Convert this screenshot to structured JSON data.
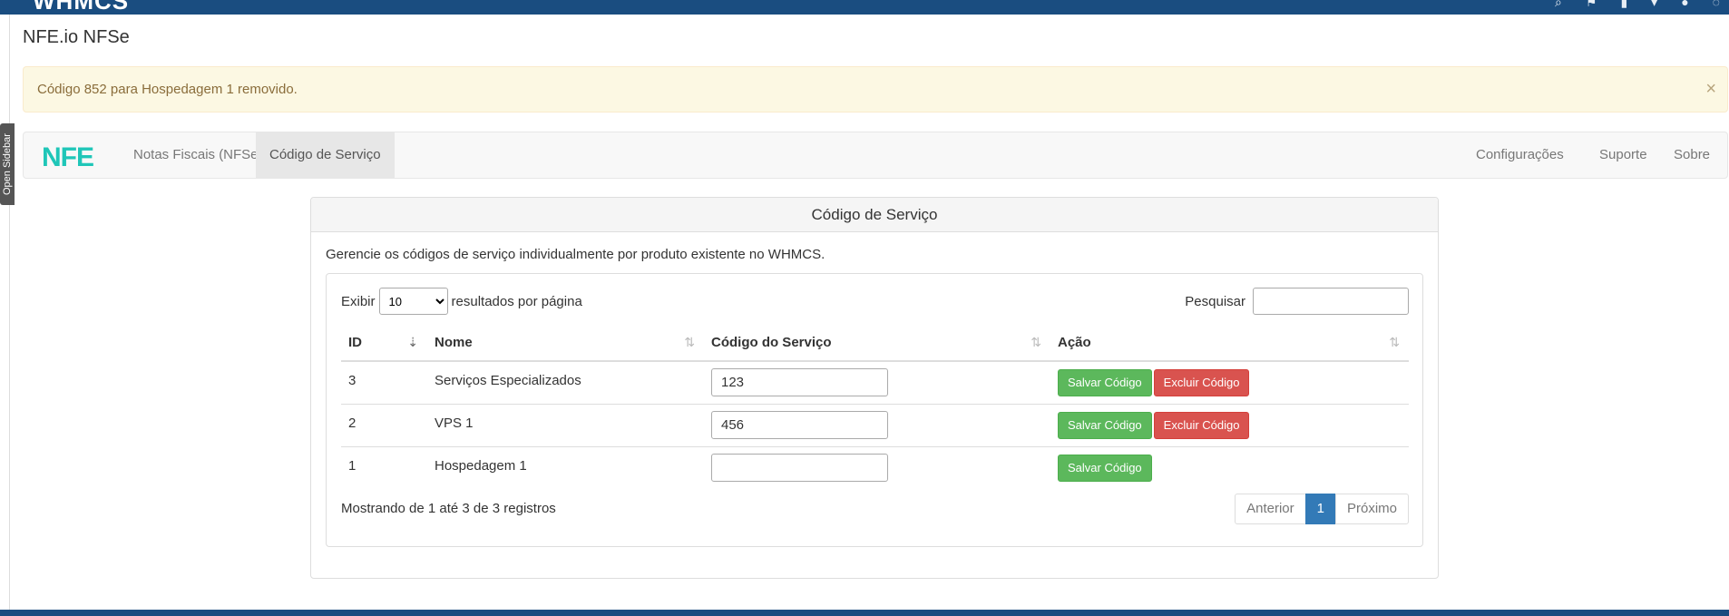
{
  "topbar": {
    "logo_text": "WHMCS",
    "icons": [
      "search-icon",
      "flag-icon",
      "note-icon",
      "down-icon",
      "avatar",
      "help-icon"
    ]
  },
  "sidebar": {
    "toggle_label": "Open Sidebar"
  },
  "page": {
    "title": "NFE.io NFSe"
  },
  "alert": {
    "message": "Código 852 para Hospedagem 1 removido.",
    "close": "×"
  },
  "nav": {
    "brand": "NFE",
    "items": [
      "Notas Fiscais (NFSe)",
      "Código de Serviço"
    ],
    "right_items": [
      "Configurações",
      "Suporte",
      "Sobre"
    ],
    "active_index": 1
  },
  "panel": {
    "title": "Código de Serviço",
    "description": "Gerencie os códigos de serviço individualmente por produto existente no WHMCS."
  },
  "table_controls": {
    "show_label": "Exibir",
    "page_size": "10",
    "per_page_label": "resultados por página",
    "search_label": "Pesquisar",
    "search_value": ""
  },
  "table": {
    "headers": [
      "ID",
      "Nome",
      "Código do Serviço",
      "Ação"
    ],
    "rows": [
      {
        "id": "3",
        "name": "Serviços Especializados",
        "code": "123",
        "save": "Salvar Código",
        "delete": "Excluir Código"
      },
      {
        "id": "2",
        "name": "VPS 1",
        "code": "456",
        "save": "Salvar Código",
        "delete": "Excluir Código"
      },
      {
        "id": "1",
        "name": "Hospedagem 1",
        "code": "",
        "save": "Salvar Código"
      }
    ]
  },
  "footer": {
    "info": "Mostrando de 1 até 3 de 3 registros",
    "prev": "Anterior",
    "page": "1",
    "next": "Próximo"
  },
  "colors": {
    "topbar": "#1a4d80",
    "brand": "#1fc6b8",
    "success": "#5cb85c",
    "danger": "#d9534f",
    "primary": "#337ab7"
  }
}
